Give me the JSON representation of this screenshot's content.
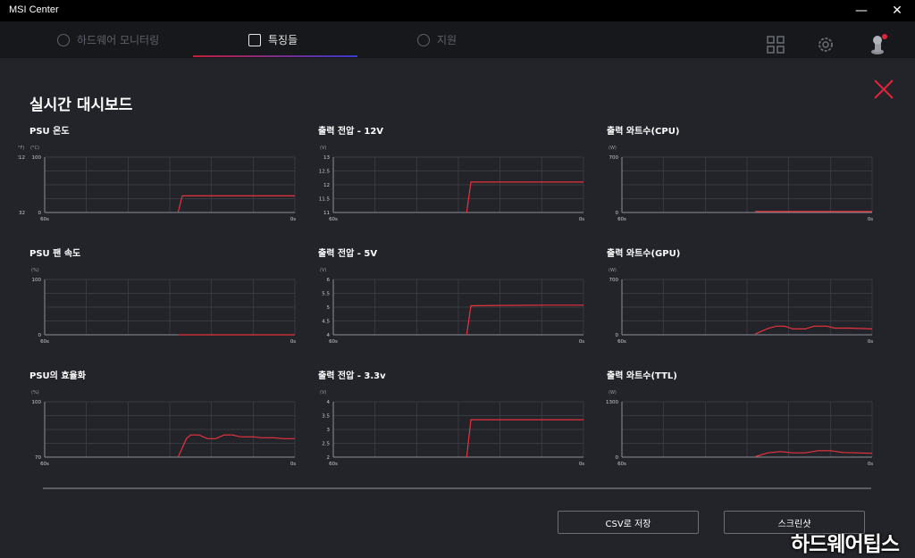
{
  "app": {
    "title": "MSI Center"
  },
  "window": {
    "minimize_glyph": "—",
    "close_glyph": "✕"
  },
  "nav": {
    "tabs": [
      {
        "label": "하드웨어 모니터링",
        "icon": "monitor-icon",
        "active": false
      },
      {
        "label": "특징들",
        "icon": "features-icon",
        "active": true
      },
      {
        "label": "지원",
        "icon": "support-icon",
        "active": false
      }
    ],
    "icons": [
      "grid-icon",
      "settings-icon",
      "user-avatar-icon"
    ]
  },
  "dashboard": {
    "title": "실시간 대시보드"
  },
  "charts": [
    {
      "title": "PSU 온도",
      "units": [
        "(°F)",
        "(°C)"
      ],
      "y_ticks": [
        "100",
        "0"
      ],
      "y_ticks_secondary": [
        "212",
        "32"
      ],
      "x_labels": [
        "60s",
        "0s"
      ]
    },
    {
      "title": "출력 전압 - 12V",
      "units": [
        "(V)"
      ],
      "y_ticks": [
        "13",
        "12.5",
        "12",
        "11.5",
        "11"
      ],
      "x_labels": [
        "60s",
        "0s"
      ]
    },
    {
      "title": "출력 와트수(CPU)",
      "units": [
        "(W)"
      ],
      "y_ticks": [
        "700",
        "0"
      ],
      "x_labels": [
        "60s",
        "0s"
      ]
    },
    {
      "title": "PSU 팬 속도",
      "units": [
        "(%)"
      ],
      "y_ticks": [
        "100",
        "0"
      ],
      "x_labels": [
        "60s",
        "0s"
      ]
    },
    {
      "title": "출력 전압 - 5V",
      "units": [
        "(V)"
      ],
      "y_ticks": [
        "6",
        "5.5",
        "5",
        "4.5",
        "4"
      ],
      "x_labels": [
        "60s",
        "0s"
      ]
    },
    {
      "title": "출력 와트수(GPU)",
      "units": [
        "(W)"
      ],
      "y_ticks": [
        "700",
        "0"
      ],
      "x_labels": [
        "60s",
        "0s"
      ]
    },
    {
      "title": "PSU의 효율화",
      "units": [
        "(%)"
      ],
      "y_ticks": [
        "100",
        "70"
      ],
      "x_labels": [
        "60s",
        "0s"
      ]
    },
    {
      "title": "출력 전압 - 3.3v",
      "units": [
        "(V)"
      ],
      "y_ticks": [
        "4",
        "3.5",
        "3",
        "2.5",
        "2"
      ],
      "x_labels": [
        "60s",
        "0s"
      ]
    },
    {
      "title": "출력 와트수(TTL)",
      "units": [
        "(W)"
      ],
      "y_ticks": [
        "1300",
        "0"
      ],
      "x_labels": [
        "60s",
        "0s"
      ]
    }
  ],
  "chart_data": [
    {
      "type": "line",
      "title": "PSU 온도",
      "x": [
        60,
        28,
        27,
        0
      ],
      "values": [
        null,
        0,
        30,
        30
      ],
      "ylim": [
        0,
        100
      ],
      "color": "#e8323c"
    },
    {
      "type": "line",
      "title": "출력 전압 - 12V",
      "x": [
        60,
        28,
        27,
        0
      ],
      "values": [
        null,
        11,
        12.1,
        12.1
      ],
      "ylim": [
        11,
        13
      ],
      "color": "#e8323c"
    },
    {
      "type": "line",
      "title": "출력 와트수(CPU)",
      "x": [
        60,
        28,
        0
      ],
      "values": [
        null,
        12,
        12
      ],
      "ylim": [
        0,
        700
      ],
      "color": "#e8323c"
    },
    {
      "type": "line",
      "title": "PSU 팬 속도",
      "x": [
        60,
        28,
        0
      ],
      "values": [
        null,
        0,
        0
      ],
      "ylim": [
        0,
        100
      ],
      "color": "#e8323c"
    },
    {
      "type": "line",
      "title": "출력 전압 - 5V",
      "x": [
        60,
        28,
        27,
        20,
        10,
        0
      ],
      "values": [
        null,
        4,
        5.05,
        5.06,
        5.07,
        5.07
      ],
      "ylim": [
        4,
        6
      ],
      "color": "#e8323c"
    },
    {
      "type": "line",
      "title": "출력 와트수(GPU)",
      "x": [
        60,
        28,
        25,
        23,
        21,
        19,
        16,
        14,
        11,
        9,
        6,
        3,
        0
      ],
      "values": [
        null,
        10,
        80,
        110,
        110,
        75,
        75,
        110,
        110,
        85,
        85,
        80,
        75
      ],
      "ylim": [
        0,
        700
      ],
      "color": "#e8323c"
    },
    {
      "type": "line",
      "title": "PSU의 효율화",
      "x": [
        60,
        28,
        26,
        25,
        23,
        21,
        19,
        17,
        15,
        13,
        10,
        8,
        5,
        3,
        0
      ],
      "values": [
        null,
        70,
        80,
        82,
        82,
        80,
        80,
        82,
        82,
        81,
        81,
        80.5,
        80.5,
        80,
        80
      ],
      "ylim": [
        70,
        100
      ],
      "color": "#e8323c"
    },
    {
      "type": "line",
      "title": "출력 전압 - 3.3v",
      "x": [
        60,
        28,
        27,
        0
      ],
      "values": [
        null,
        2,
        3.35,
        3.35
      ],
      "ylim": [
        2,
        4
      ],
      "color": "#e8323c"
    },
    {
      "type": "line",
      "title": "출력 와트수(TTL)",
      "x": [
        60,
        28,
        25,
        22,
        19,
        16,
        13,
        10,
        7,
        4,
        0
      ],
      "values": [
        null,
        10,
        100,
        130,
        100,
        100,
        150,
        150,
        110,
        100,
        90
      ],
      "ylim": [
        0,
        1300
      ],
      "color": "#e8323c"
    }
  ],
  "buttons": {
    "csv_label": "CSV로 저장",
    "screenshot_label": "스크린샷"
  },
  "watermark": "하드웨어팁스"
}
